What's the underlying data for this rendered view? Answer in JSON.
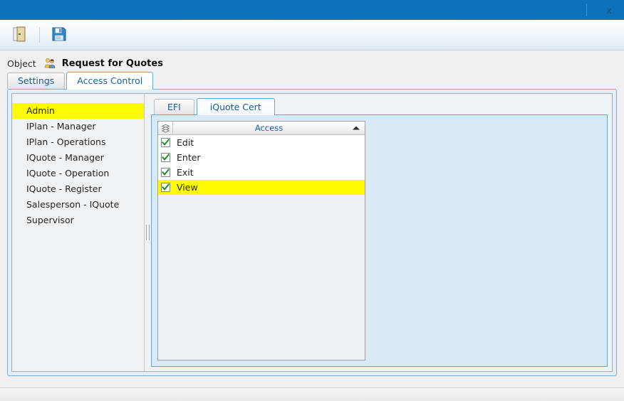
{
  "window": {
    "close_label": "x",
    "accent_blue": "#0d72b9",
    "highlight_yellow": "#fffb00",
    "link_blue": "#1c5a92",
    "check_green": "#1a8a1a"
  },
  "toolbar": {
    "buttons": [
      {
        "name": "exit-button",
        "icon": "door-exit-icon",
        "title": "Exit"
      },
      {
        "name": "save-button",
        "icon": "floppy-save-icon",
        "title": "Save"
      }
    ]
  },
  "object_header": {
    "label": "Object",
    "icon": "user-person-icon",
    "title": "Request for Quotes"
  },
  "tabs": [
    {
      "label": "Settings",
      "active": false
    },
    {
      "label": "Access Control",
      "active": true
    }
  ],
  "roles": {
    "items": [
      {
        "label": "Admin",
        "selected": true
      },
      {
        "label": "IPlan - Manager",
        "selected": false
      },
      {
        "label": "IPlan - Operations",
        "selected": false
      },
      {
        "label": "IQuote - Manager",
        "selected": false
      },
      {
        "label": "IQuote - Operation",
        "selected": false
      },
      {
        "label": "IQuote - Register",
        "selected": false
      },
      {
        "label": "Salesperson - IQuote",
        "selected": false
      },
      {
        "label": "Supervisor",
        "selected": false
      }
    ]
  },
  "inner_tabs": [
    {
      "label": "EFI",
      "active": false
    },
    {
      "label": "iQuote Cert",
      "active": true
    }
  ],
  "grid": {
    "column_chooser_icon": "column-chooser-icon",
    "columns": [
      {
        "label": "Access",
        "sort": "ascending"
      }
    ],
    "rows": [
      {
        "checked": true,
        "label": "Edit",
        "highlight": false
      },
      {
        "checked": true,
        "label": "Enter",
        "highlight": false
      },
      {
        "checked": true,
        "label": "Exit",
        "highlight": false
      },
      {
        "checked": true,
        "label": "View",
        "highlight": true
      }
    ]
  }
}
